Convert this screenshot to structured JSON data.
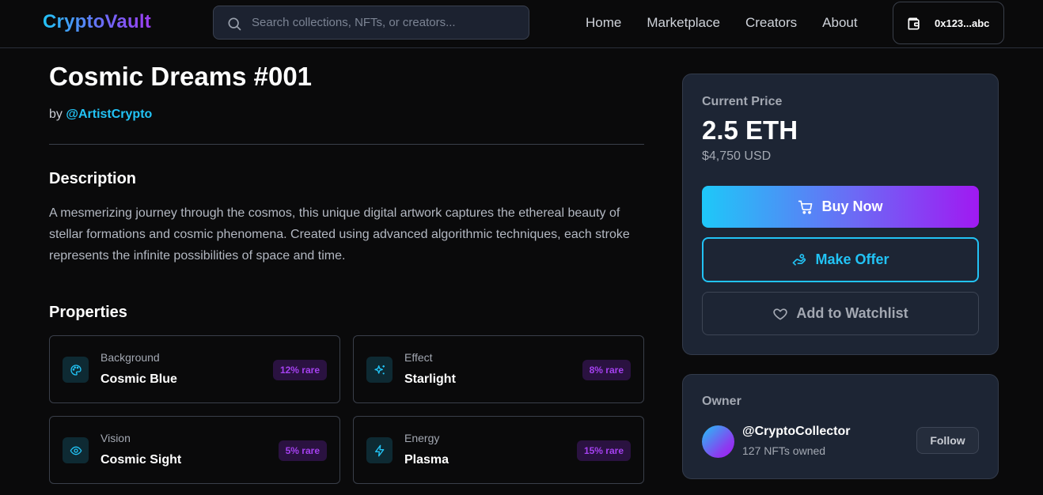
{
  "header": {
    "logo": "CryptoVault",
    "search_placeholder": "Search collections, NFTs, or creators...",
    "nav": [
      "Home",
      "Marketplace",
      "Creators",
      "About"
    ],
    "wallet_address": "0x123...abc"
  },
  "nft": {
    "title": "Cosmic Dreams #001",
    "by_prefix": "by",
    "artist": "@ArtistCrypto"
  },
  "description": {
    "heading": "Description",
    "text": "A mesmerizing journey through the cosmos, this unique digital artwork captures the ethereal beauty of stellar formations and cosmic phenomena. Created using advanced algorithmic techniques, each stroke represents the infinite possibilities of space and time."
  },
  "properties": {
    "heading": "Properties",
    "items": [
      {
        "label": "Background",
        "value": "Cosmic Blue",
        "rarity": "12% rare",
        "icon": "palette-icon"
      },
      {
        "label": "Effect",
        "value": "Starlight",
        "rarity": "8% rare",
        "icon": "sparkles-icon"
      },
      {
        "label": "Vision",
        "value": "Cosmic Sight",
        "rarity": "5% rare",
        "icon": "eye-icon"
      },
      {
        "label": "Energy",
        "value": "Plasma",
        "rarity": "15% rare",
        "icon": "lightning-icon"
      }
    ]
  },
  "pricing": {
    "label": "Current Price",
    "eth": "2.5 ETH",
    "usd": "$4,750 USD",
    "buy_label": "Buy Now",
    "offer_label": "Make Offer",
    "watchlist_label": "Add to Watchlist"
  },
  "owner": {
    "label": "Owner",
    "name": "@CryptoCollector",
    "count": "127 NFTs owned",
    "follow_label": "Follow"
  },
  "colors": {
    "accent_cyan": "#22c3f5",
    "accent_purple": "#a019f2",
    "card_bg": "#1d2534",
    "page_bg": "#0a0a0b"
  }
}
